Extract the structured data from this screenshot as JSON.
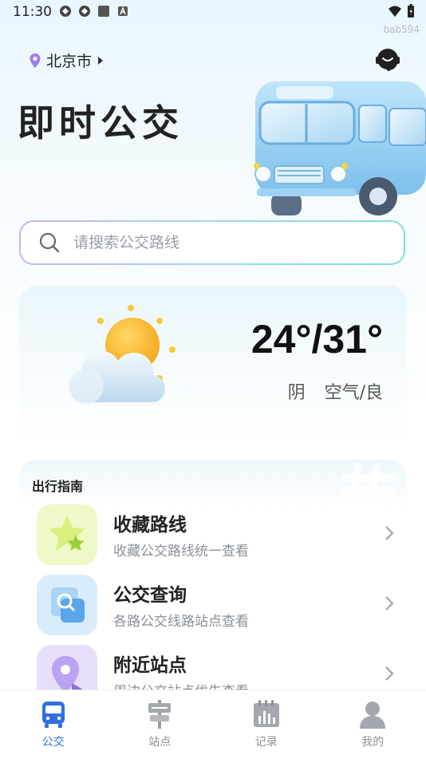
{
  "status_bar": {
    "time": "11:30",
    "device_tag": "bab594",
    "icons": [
      "app-icon",
      "app-icon",
      "square-icon",
      "a-icon"
    ],
    "right_icons": [
      "wifi-icon",
      "battery-icon"
    ]
  },
  "header": {
    "city": "北京市",
    "app_title": "即时公交",
    "icons": {
      "location": "location-pin-icon",
      "dropdown": "triangle-right-icon",
      "service": "customer-service-icon"
    }
  },
  "search": {
    "placeholder": "请搜索公交路线",
    "value": ""
  },
  "weather": {
    "temperature": "24°/31°",
    "condition": "阴",
    "air_quality": "空气/良",
    "icon": "cloudy-sun-icon"
  },
  "guide": {
    "title": "出行指南",
    "items": [
      {
        "title": "收藏路线",
        "desc": "收藏公交路线统一查看",
        "icon": "star-icon",
        "icon_bg": "#eef8c8"
      },
      {
        "title": "公交查询",
        "desc": "各路公交线路站点查看",
        "icon": "magnifier-card-icon",
        "icon_bg": "#d8ecfb"
      },
      {
        "title": "附近站点",
        "desc": "周边公交站点优先查看",
        "icon": "location-pin-icon",
        "icon_bg": "#e6defa"
      }
    ]
  },
  "tabbar": {
    "tabs": [
      {
        "label": "公交",
        "icon": "bus-icon",
        "active": true
      },
      {
        "label": "站点",
        "icon": "bus-stop-icon",
        "active": false
      },
      {
        "label": "记录",
        "icon": "record-icon",
        "active": false
      },
      {
        "label": "我的",
        "icon": "user-icon",
        "active": false
      }
    ]
  },
  "colors": {
    "accent": "#2f6fe0",
    "location_pin": "#9b7cf0",
    "tab_inactive": "#8d8f94"
  }
}
